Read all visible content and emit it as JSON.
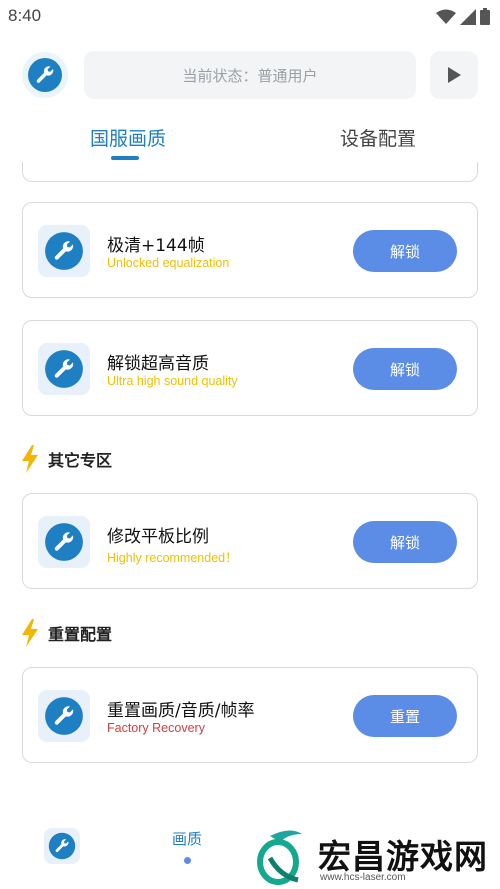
{
  "status_bar": {
    "time": "8:40"
  },
  "header": {
    "status_text": "当前状态：普通用户"
  },
  "tabs": [
    {
      "label": "国服画质",
      "active": true
    },
    {
      "label": "设备配置",
      "active": false
    }
  ],
  "cards": [
    {
      "title": "极清+144帧",
      "subtitle": "Unlocked equalization",
      "button": "解锁"
    },
    {
      "title": "解锁超高音质",
      "subtitle": "Ultra high sound quality",
      "button": "解锁"
    },
    {
      "title": "修改平板比例",
      "subtitle": "Highly recommended！",
      "button": "解锁"
    },
    {
      "title": "重置画质/音质/帧率",
      "subtitle": "Factory Recovery",
      "button": "重置"
    }
  ],
  "sections": [
    {
      "title": "其它专区"
    },
    {
      "title": "重置配置"
    }
  ],
  "bottom_nav": {
    "quality_label": "画质"
  },
  "watermark": {
    "title": "宏昌游戏网",
    "url": "www.hcs-laser.com"
  },
  "colors": {
    "accent": "#1e7fc2",
    "button": "#5b8de6",
    "subtitle_yellow": "#f0c000",
    "subtitle_red": "#d63d3d"
  },
  "icons": {
    "app": "wrench-icon",
    "section": "lightning-icon",
    "play": "play-icon"
  }
}
